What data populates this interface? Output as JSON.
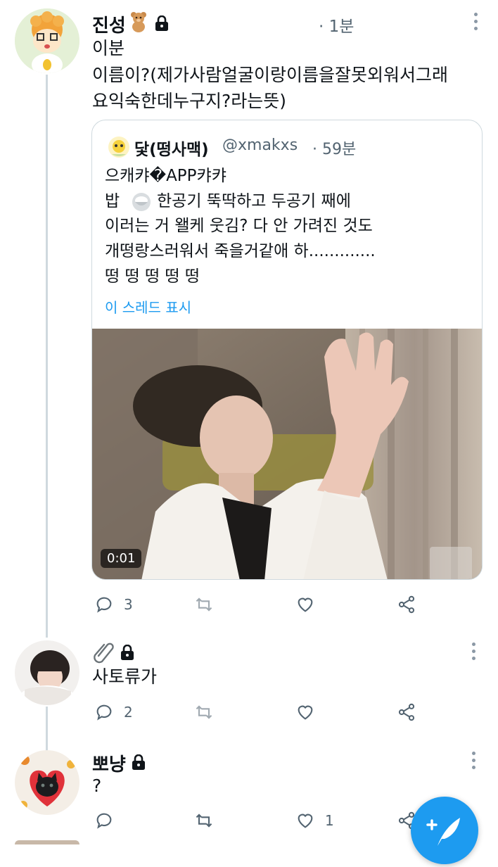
{
  "tweets": [
    {
      "name": "진성",
      "time": "· 1분",
      "lines": [
        "이분",
        "이름이?(제가사람얼굴이랑이름을잘못외워서그래",
        "요익숙한데누구지?라는뜻)"
      ],
      "replies": "3",
      "retweets": "",
      "likes": ""
    },
    {
      "name": "",
      "lines": [
        "사토류가"
      ],
      "replies": "2",
      "retweets": "",
      "likes": ""
    },
    {
      "name": "뽀냥",
      "lines": [
        "?"
      ],
      "replies": "",
      "retweets": "",
      "likes": "1"
    }
  ],
  "quote": {
    "name": "닻(떵사맥)",
    "handle": "@xmakxs",
    "time": "· 59분",
    "lines": [
      "으캐캬�APP캬캬",
      "밥",
      "한공기 뚝딱하고 두공기 째에",
      "이러는 거 왤케 웃김? 다 안 가려진 것도",
      "개떵랑스러워서 죽을거같애 하.............",
      "떵 떵 떵 떵 떵"
    ],
    "show_thread": "이 스레드 표시",
    "video_duration": "0:01"
  },
  "icons": [
    "reply-icon",
    "retweet-icon",
    "like-icon",
    "share-icon",
    "lock-icon",
    "more-icon",
    "compose-icon",
    "teddy-bear-emoji",
    "paperclip-emoji",
    "rice-bowl-emoji"
  ],
  "colors": {
    "accent": "#1d9bf0",
    "muted": "#536471",
    "border": "#cfd9de"
  }
}
